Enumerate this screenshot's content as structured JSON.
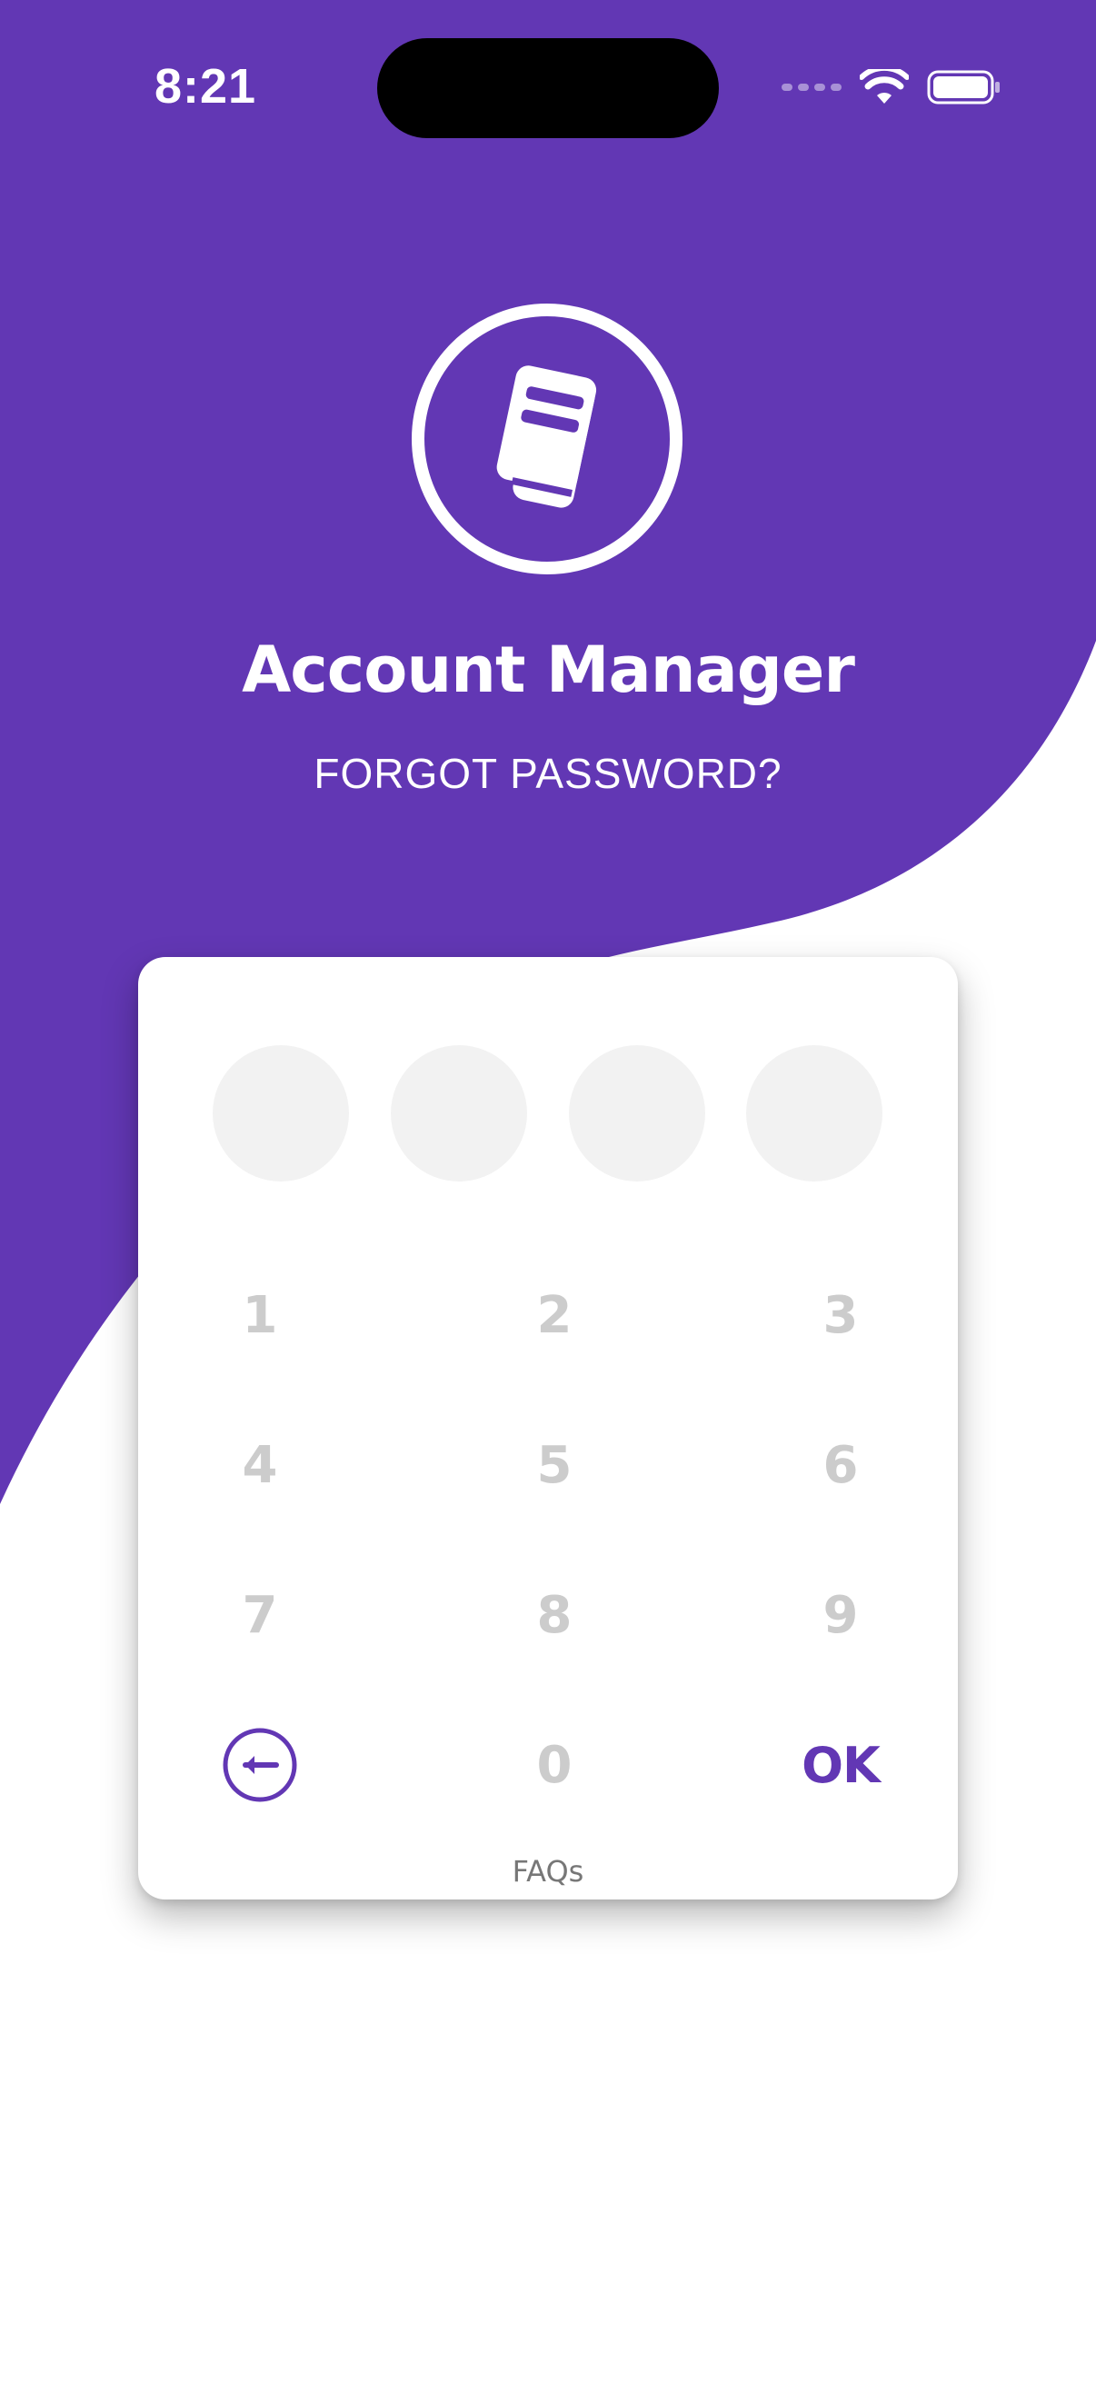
{
  "status_bar": {
    "time": "8:21"
  },
  "header": {
    "logo_icon": "book-icon",
    "title": "Account Manager",
    "subtitle": "FORGOT PASSWORD?"
  },
  "pin_pad": {
    "pin_dots_filled": 0,
    "pin_length": 4,
    "keys": [
      "1",
      "2",
      "3",
      "4",
      "5",
      "6",
      "7",
      "8",
      "9",
      "0"
    ],
    "back_icon": "arrow-left-icon",
    "ok_label": "OK",
    "faqs_label": "FAQs"
  },
  "colors": {
    "brand_purple": "#6237b4",
    "dot_empty": "#f2f2f2",
    "key_text": "#cccccc",
    "background": "#ffffff"
  }
}
